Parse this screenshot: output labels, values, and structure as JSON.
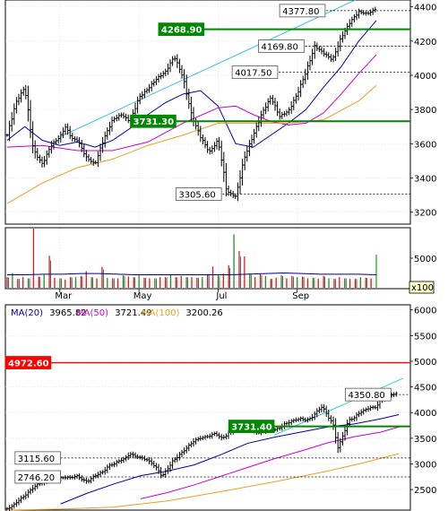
{
  "chart_data": [
    {
      "panel": "daily",
      "type": "line",
      "chart_style": "ohlc bars with moving averages, trend channel and horizontal levels",
      "x_ticks": [
        "Mar",
        "May",
        "Jul",
        "Sep"
      ],
      "y_ticks": [
        "3200",
        "3400",
        "3600",
        "3800",
        "4000",
        "4200",
        "4400"
      ],
      "ylim": [
        3130,
        4440
      ],
      "grid": true,
      "series": [
        {
          "key": "price",
          "color": "#000000",
          "x": [
            0,
            5,
            10,
            15,
            20,
            25,
            30,
            33,
            37,
            40,
            45,
            50,
            55,
            60,
            65,
            70,
            75,
            80,
            85,
            90,
            95,
            100,
            105,
            110,
            115,
            120,
            125,
            130,
            135,
            140,
            145,
            150,
            155,
            160,
            165,
            170,
            175,
            180,
            185,
            190,
            195,
            200,
            205,
            210
          ],
          "y": [
            3650,
            3840,
            3930,
            3560,
            3480,
            3590,
            3640,
            3700,
            3630,
            3620,
            3520,
            3480,
            3630,
            3740,
            3770,
            3730,
            3870,
            3920,
            3980,
            4020,
            4110,
            3990,
            3760,
            3640,
            3550,
            3620,
            3320,
            3290,
            3520,
            3650,
            3780,
            3870,
            3760,
            3790,
            3890,
            4020,
            4170,
            4130,
            4090,
            4220,
            4310,
            4370,
            4360,
            4390
          ]
        },
        {
          "key": "ma_short",
          "color": "#0000aa",
          "x": [
            0,
            10,
            20,
            30,
            40,
            50,
            60,
            70,
            80,
            90,
            100,
            110,
            120,
            130,
            140,
            150,
            160,
            170,
            180,
            190,
            200,
            210
          ],
          "y": [
            3620,
            3700,
            3620,
            3590,
            3610,
            3580,
            3620,
            3690,
            3770,
            3840,
            3890,
            3910,
            3820,
            3600,
            3580,
            3650,
            3720,
            3800,
            3930,
            4050,
            4200,
            4320
          ]
        },
        {
          "key": "ma_medium",
          "color": "#cc00cc",
          "x": [
            0,
            20,
            40,
            60,
            80,
            100,
            120,
            130,
            140,
            150,
            160,
            170,
            180,
            190,
            200,
            210
          ],
          "y": [
            3580,
            3590,
            3560,
            3560,
            3610,
            3720,
            3810,
            3820,
            3770,
            3730,
            3710,
            3720,
            3780,
            3890,
            4010,
            4120
          ]
        },
        {
          "key": "ma_long",
          "color": "#e8a020",
          "x": [
            0,
            20,
            40,
            60,
            80,
            100,
            120,
            140,
            160,
            180,
            200,
            210
          ],
          "y": [
            3250,
            3370,
            3460,
            3510,
            3590,
            3650,
            3720,
            3720,
            3720,
            3740,
            3850,
            3940
          ]
        },
        {
          "key": "trend_channel",
          "color": "#22bbdd",
          "x": [
            30,
            198
          ],
          "y": [
            3640,
            4440
          ]
        }
      ],
      "levels": [
        {
          "label": "4377.80",
          "value": 4377.8,
          "x_start": 155,
          "label_pos": "inline",
          "style": "dashed"
        },
        {
          "label": "4268.90",
          "value": 4268.9,
          "x_start": 112,
          "label_pos": "left",
          "style": "solid",
          "color": "#008800"
        },
        {
          "label": "4169.80",
          "value": 4169.8,
          "x_start": 143,
          "label_pos": "inline",
          "style": "dashed"
        },
        {
          "label": "4017.50",
          "value": 4017.5,
          "x_start": 128,
          "label_pos": "inline",
          "style": "dashed"
        },
        {
          "label": "3731.30",
          "value": 3731.3,
          "x_start": 96,
          "label_pos": "left",
          "style": "solid",
          "color": "#008800"
        },
        {
          "label": "3305.60",
          "value": 3305.6,
          "x_start": 96,
          "label_pos": "inline",
          "style": "dashed"
        }
      ]
    },
    {
      "panel": "volume",
      "type": "bar",
      "x_ticks": [
        "Mar",
        "May",
        "Jul",
        "Sep"
      ],
      "y_ticks": [
        "5000"
      ],
      "scale_label": "x100",
      "ylim": [
        0,
        10000
      ],
      "average_color": "#000088",
      "x": [
        0,
        3,
        6,
        9,
        12,
        15,
        18,
        21,
        24,
        27,
        30,
        33,
        36,
        39,
        42,
        45,
        48,
        51,
        54,
        57,
        60,
        63,
        66,
        69,
        72,
        75,
        78,
        81,
        84,
        87,
        90,
        93,
        96,
        99,
        102,
        105,
        108,
        111,
        114,
        117,
        120,
        123,
        126,
        129,
        132,
        135,
        138,
        141,
        144,
        147,
        150,
        153,
        156,
        159,
        162,
        165,
        168,
        171,
        174,
        177,
        180,
        183,
        186,
        189,
        192,
        195,
        198,
        201,
        204,
        207,
        210
      ],
      "values": [
        1800,
        2500,
        1500,
        1800,
        1600,
        10000,
        1900,
        2200,
        5400,
        1700,
        1600,
        1400,
        1800,
        1800,
        2000,
        2800,
        1800,
        1600,
        3500,
        1700,
        1600,
        1600,
        2100,
        1900,
        1800,
        2100,
        1700,
        1600,
        1600,
        1800,
        1800,
        2200,
        1800,
        2000,
        1800,
        1800,
        1700,
        1800,
        2300,
        3600,
        2100,
        2400,
        3800,
        9000,
        6200,
        5300,
        2400,
        1800,
        2300,
        2000,
        1500,
        1700,
        2100,
        1600,
        2000,
        1800,
        1900,
        1600,
        1700,
        1500,
        2000,
        1600,
        1500,
        1800,
        1600,
        1500,
        1500,
        1800,
        1700,
        1600,
        5600
      ],
      "average": [
        2200,
        2200,
        2300,
        2300,
        2400,
        2400,
        2300,
        2200,
        2200,
        2200,
        2200,
        2200,
        2200,
        2300,
        2400,
        2500,
        2400,
        2300,
        2300,
        2300,
        2200
      ]
    },
    {
      "panel": "weekly",
      "type": "line",
      "chart_style": "ohlc bars with moving averages, trend channel and horizontal levels",
      "legend": [
        {
          "name": "MA(20)",
          "value": "3965.82",
          "color": "#0000aa"
        },
        {
          "name": "MA(50)",
          "value": "3721.49",
          "color": "#cc00cc"
        },
        {
          "name": "MA(100)",
          "value": "3200.26",
          "color": "#e8a020"
        }
      ],
      "y_ticks": [
        "2500",
        "3000",
        "3500",
        "4000",
        "4500",
        "5000",
        "5500",
        "6000"
      ],
      "ylim": [
        2100,
        6100
      ],
      "grid": true,
      "series": [
        {
          "key": "price",
          "color": "#000000",
          "x": [
            0,
            6,
            12,
            18,
            24,
            30,
            36,
            42,
            48,
            54,
            60,
            66,
            72,
            78,
            84,
            90,
            96,
            102,
            108,
            114,
            120,
            126,
            132,
            138,
            144,
            150,
            156,
            162,
            168,
            174,
            180,
            186,
            192,
            198,
            204,
            210,
            216,
            222,
            228,
            234,
            240,
            246,
            252,
            258,
            264,
            270,
            276,
            282,
            288,
            294,
            300,
            306,
            312,
            318,
            324,
            330,
            336,
            342,
            348,
            354,
            360,
            366,
            372,
            378,
            384,
            390,
            396,
            402,
            408,
            414,
            420,
            426,
            432,
            438
          ],
          "y": [
            2130,
            2180,
            2280,
            2360,
            2450,
            2550,
            2620,
            2640,
            2700,
            2680,
            2720,
            2740,
            2730,
            2770,
            2700,
            2650,
            2740,
            2800,
            2850,
            2960,
            3000,
            3060,
            3100,
            3200,
            3150,
            3120,
            3090,
            3020,
            2920,
            2760,
            2900,
            3050,
            3150,
            3250,
            3350,
            3450,
            3500,
            3520,
            3550,
            3600,
            3500,
            3550,
            3650,
            3800,
            3780,
            3700,
            3650,
            3600,
            3640,
            3700,
            3660,
            3700,
            3780,
            3820,
            3860,
            3880,
            3850,
            3900,
            4020,
            4120,
            3940,
            3780,
            3300,
            3600,
            3850,
            3900,
            4000,
            4050,
            4100,
            4100,
            4250,
            4300,
            4350,
            4370
          ]
        },
        {
          "key": "ma_short",
          "color": "#0000aa",
          "x": [
            60,
            90,
            120,
            150,
            180,
            210,
            240,
            270,
            300,
            330,
            360,
            390,
            420,
            440
          ],
          "y": [
            2220,
            2430,
            2610,
            2770,
            2860,
            2980,
            3180,
            3400,
            3520,
            3620,
            3720,
            3780,
            3880,
            3960
          ]
        },
        {
          "key": "ma_medium",
          "color": "#cc00cc",
          "x": [
            150,
            180,
            210,
            240,
            270,
            300,
            330,
            360,
            390,
            420,
            440
          ],
          "y": [
            2320,
            2440,
            2590,
            2760,
            2930,
            3100,
            3250,
            3410,
            3530,
            3620,
            3720
          ]
        },
        {
          "key": "ma_long",
          "color": "#e8a020",
          "x": [
            0,
            60,
            120,
            180,
            240,
            300,
            360,
            400,
            440
          ],
          "y": [
            2100,
            2120,
            2160,
            2280,
            2460,
            2650,
            2860,
            3020,
            3200
          ]
        },
        {
          "key": "trend_channel",
          "color": "#22bbdd",
          "x": [
            300,
            445
          ],
          "y": [
            3560,
            4670
          ]
        }
      ],
      "levels": [
        {
          "label": "4972.60",
          "value": 4972.6,
          "x_start": 0,
          "label_pos": "left",
          "style": "solid",
          "color": "#ff0000"
        },
        {
          "label": "4350.80",
          "value": 4350.8,
          "x_start": 380,
          "label_pos": "inline",
          "style": "dashed"
        },
        {
          "label": "3731.40",
          "value": 3731.4,
          "x_start": 300,
          "label_pos": "left",
          "style": "solid",
          "color": "#008800"
        },
        {
          "label": "3115.60",
          "value": 3115.6,
          "x_start": 60,
          "label_pos": "left",
          "style": "dashed"
        },
        {
          "label": "2746.20",
          "value": 2746.2,
          "x_start": 60,
          "label_pos": "left",
          "style": "dashed"
        }
      ]
    }
  ]
}
